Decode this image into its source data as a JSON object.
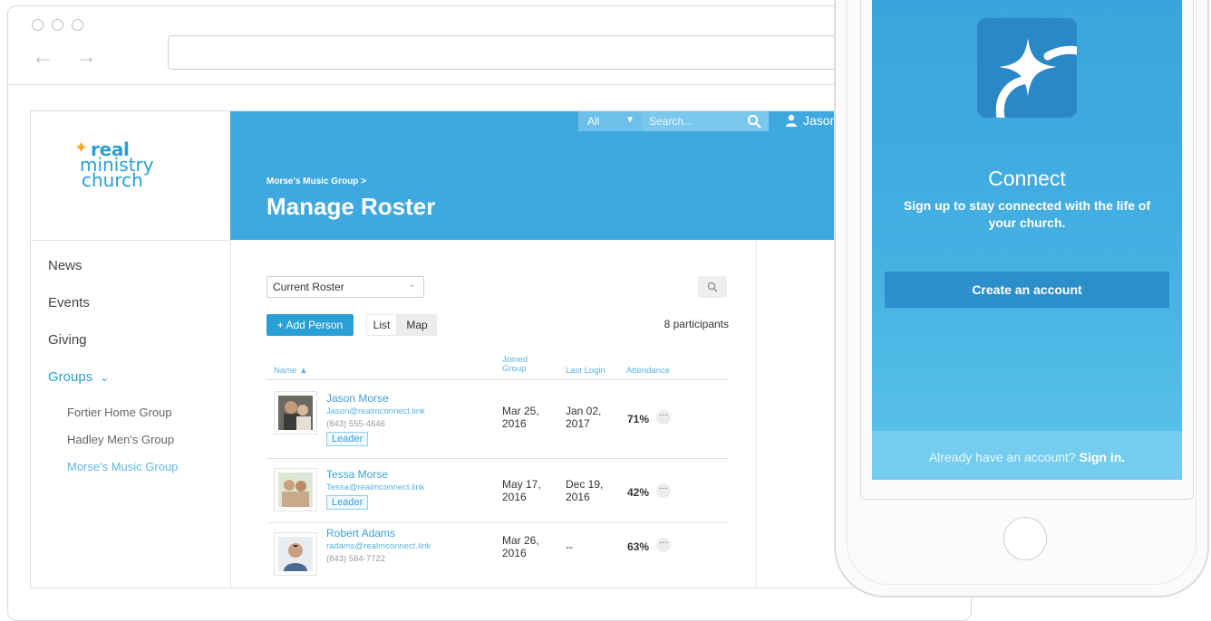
{
  "browser": {
    "back_glyph": "←",
    "forward_glyph": "→"
  },
  "logo": {
    "line1": "real",
    "line2": "ministry",
    "line3": "church",
    "star": "✦",
    "colors": {
      "text": "#2a9fd6",
      "star": "#f2a81d"
    }
  },
  "sidebar": {
    "items": [
      {
        "label": "News"
      },
      {
        "label": "Events"
      },
      {
        "label": "Giving"
      },
      {
        "label": "Groups",
        "chevron": "⌄"
      }
    ],
    "groups": [
      {
        "label": "Fortier Home Group"
      },
      {
        "label": "Hadley Men's Group"
      },
      {
        "label": "Morse's Music Group",
        "active": true
      }
    ]
  },
  "header": {
    "scope": "All",
    "search_placeholder": "Search...",
    "user": "Jason",
    "breadcrumb": "Morse's Music Group >",
    "title": "Manage Roster",
    "accent": "#3fa9df"
  },
  "roster": {
    "select_value": "Current Roster",
    "add_person": "+ Add Person",
    "view_list": "List",
    "view_map": "Map",
    "count": "8 participants",
    "columns": {
      "name": "Name ▲",
      "joined": [
        "Joined",
        "Group"
      ],
      "last_login": "Last Login",
      "attendance": "Attendance"
    },
    "rows": [
      {
        "name": "Jason Morse",
        "email": "Jason@realmconnect.link",
        "phone": "(843) 555-4646",
        "badge": "Leader",
        "joined": [
          "Mar 25,",
          "2016"
        ],
        "last_login": [
          "Jan 02,",
          "2017"
        ],
        "attendance": "71%"
      },
      {
        "name": "Tessa Morse",
        "email": "Tessa@realmconnect.link",
        "phone": "",
        "badge": "Leader",
        "joined": [
          "May 17,",
          "2016"
        ],
        "last_login": [
          "Dec 19,",
          "2016"
        ],
        "attendance": "42%"
      },
      {
        "name": "Robert Adams",
        "email": "radams@realmconnect.link",
        "phone": "(843) 564-7722",
        "badge": "",
        "joined": [
          "Mar 26,",
          "2016"
        ],
        "last_login": [
          "--"
        ],
        "attendance": "63%"
      }
    ],
    "more_glyph": "···"
  },
  "phone": {
    "heading": "Connect",
    "tagline_1": "Sign up to stay connected with the life of",
    "tagline_2": "your church.",
    "create_button": "Create an account",
    "signin_prefix": "Already have an account?",
    "signin_link": "Sign in."
  }
}
